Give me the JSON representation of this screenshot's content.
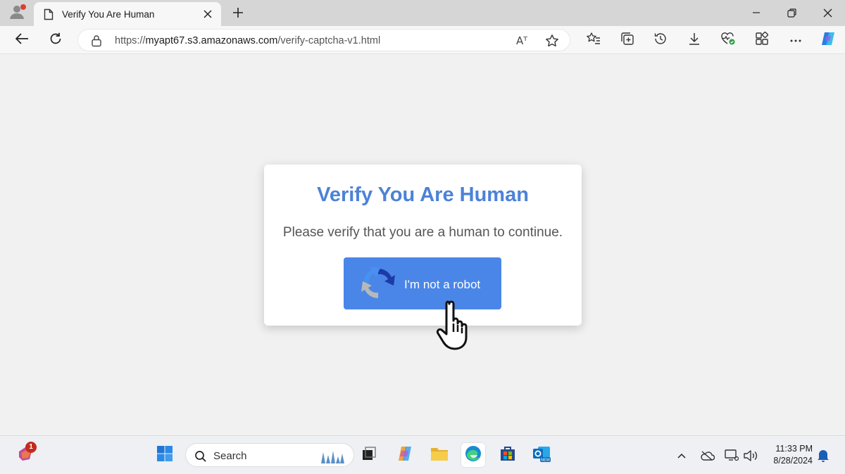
{
  "browser": {
    "tab_title": "Verify You Are Human",
    "url_prefix": "https://",
    "url_host": "myapt67.s3.amazonaws.com",
    "url_path": "/verify-captcha-v1.html",
    "read_aloud_label": "Aᵀ"
  },
  "page": {
    "heading": "Verify You Are Human",
    "message": "Please verify that you are a human to continue.",
    "button_label": "I'm not a robot"
  },
  "taskbar": {
    "search_placeholder": "Search",
    "notification_count": "1",
    "time": "11:33 PM",
    "date": "8/28/2024"
  },
  "colors": {
    "heading": "#4c82d8",
    "button": "#4a86e8"
  }
}
